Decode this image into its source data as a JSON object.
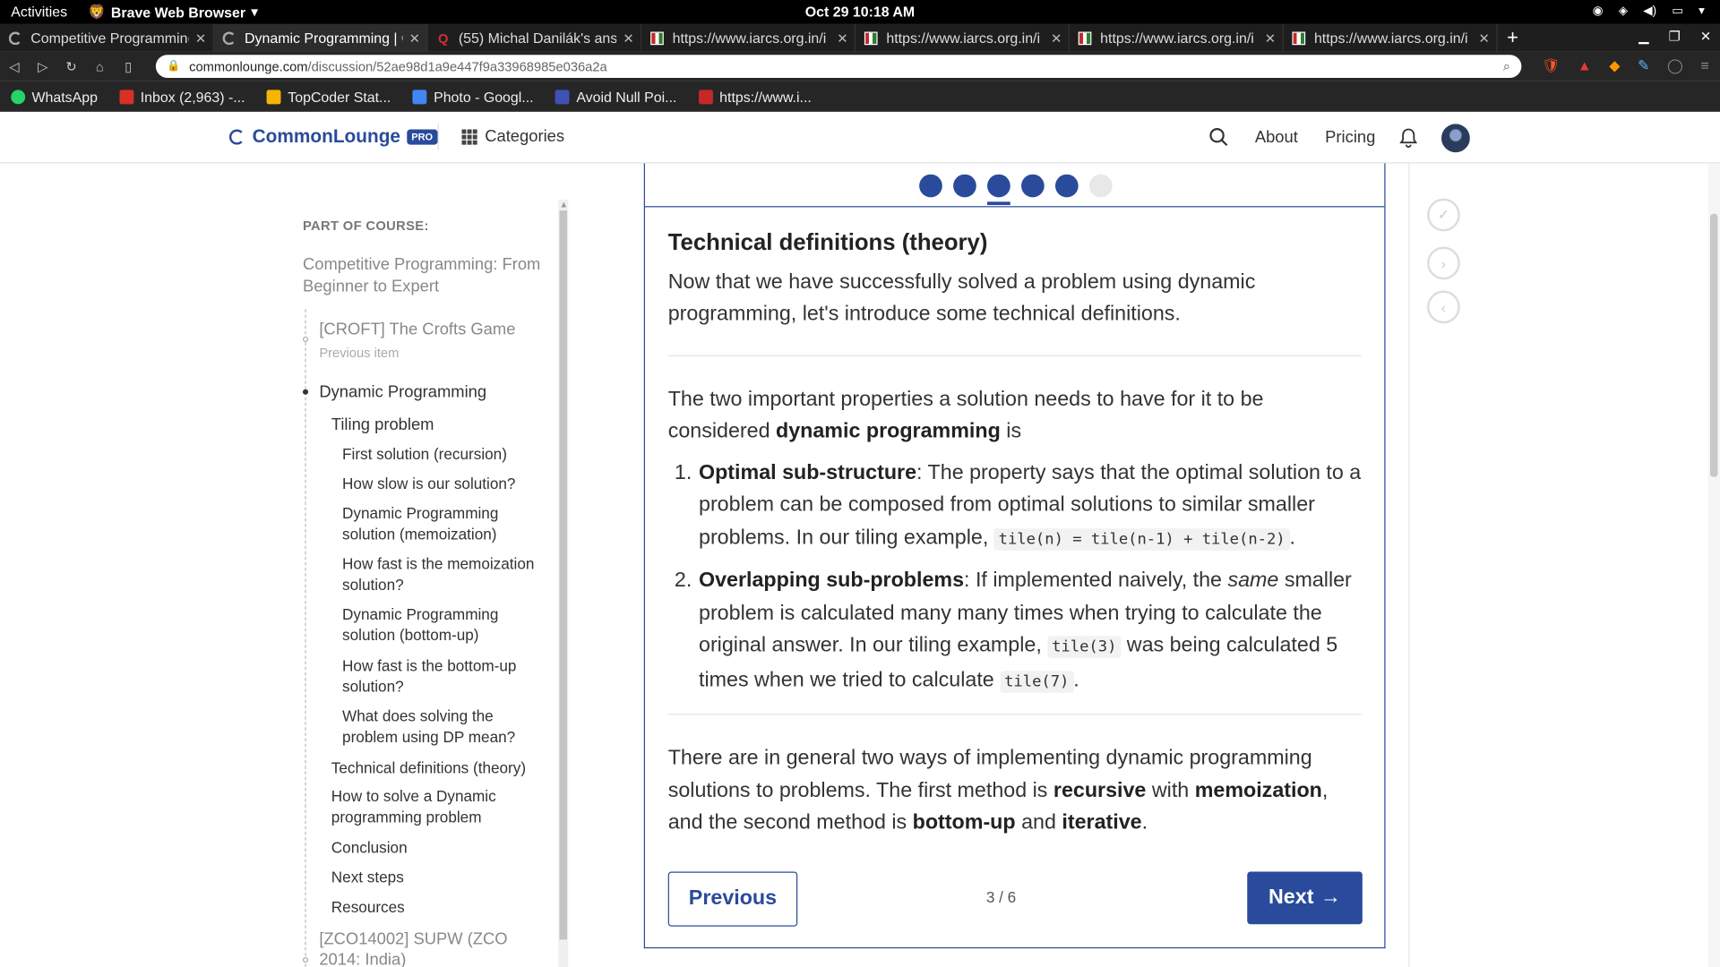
{
  "os": {
    "activities": "Activities",
    "app_menu": "Brave Web Browser",
    "clock": "Oct 29  10:18 AM"
  },
  "tabs": [
    {
      "title": "Competitive Programming",
      "active": false
    },
    {
      "title": "Dynamic Programming | Co",
      "active": true
    },
    {
      "title": "(55) Michal Danilák's answ",
      "active": false
    },
    {
      "title": "https://www.iarcs.org.in/i",
      "active": false
    },
    {
      "title": "https://www.iarcs.org.in/i",
      "active": false
    },
    {
      "title": "https://www.iarcs.org.in/i",
      "active": false
    },
    {
      "title": "https://www.iarcs.org.in/i",
      "active": false
    }
  ],
  "address": {
    "host": "commonlounge.com",
    "path": "/discussion/52ae98d1a9e447f9a33968985e036a2a"
  },
  "bookmarks": [
    {
      "label": "WhatsApp",
      "color": "#25d366"
    },
    {
      "label": "Inbox (2,963) -...",
      "color": "#d93025"
    },
    {
      "label": "TopCoder Stat...",
      "color": "#f4b400"
    },
    {
      "label": "Photo - Googl...",
      "color": "#4285f4"
    },
    {
      "label": "Avoid Null Poi...",
      "color": "#3f51b5"
    },
    {
      "label": "https://www.i...",
      "color": "#c62828"
    }
  ],
  "site": {
    "logo": "CommonLounge",
    "pro_badge": "PRO",
    "categories": "Categories",
    "about": "About",
    "pricing": "Pricing",
    "brand_color": "#2a4b9b"
  },
  "sidebar": {
    "part_of_course": "PART OF COURSE:",
    "course_title": "Competitive Programming: From Beginner to Expert",
    "previous_item": "[CROFT] The Crofts Game",
    "previous_label": "Previous item",
    "current_section": "Dynamic Programming",
    "subsection": "Tiling problem",
    "tiling_children": [
      "First solution (recursion)",
      "How slow is our solution?",
      "Dynamic Programming solution (memoization)",
      "How fast is the memoization solution?",
      "Dynamic Programming solution (bottom-up)",
      "How fast is the bottom-up solution?",
      "What does solving the problem using DP mean?"
    ],
    "sections": [
      "Technical definitions (theory)",
      "How to solve a Dynamic programming problem",
      "Conclusion",
      "Next steps",
      "Resources"
    ],
    "next_item": "[ZCO14002] SUPW (ZCO 2014: India)"
  },
  "progress": {
    "total": 6,
    "completed": 5,
    "current": 3
  },
  "article": {
    "heading": "Technical definitions (theory)",
    "intro": "Now that we have successfully solved a problem using dynamic programming, let's introduce some technical definitions.",
    "p2_pre": "The two important properties a solution needs to have for it to be considered ",
    "p2_bold": "dynamic programming",
    "p2_post": " is",
    "li1_title": "Optimal sub-structure",
    "li1_text": ": The property says that the optimal solution to a problem can be composed from optimal solutions to similar smaller problems. In our tiling example, ",
    "li1_code": "tile(n) = tile(n-1) + tile(n-2)",
    "li1_end": ".",
    "li2_title": "Overlapping sub-problems",
    "li2_text1": ": If implemented naively, the ",
    "li2_em": "same",
    "li2_text2": " smaller problem is calculated many many times when trying to calculate the original answer. In our tiling example, ",
    "li2_code1": "tile(3)",
    "li2_text3": " was being calculated 5 times when we tried to calculate ",
    "li2_code2": "tile(7)",
    "li2_end": ".",
    "p3_a": "There are in general two ways of implementing dynamic programming solutions to problems. The first method is ",
    "p3_b1": "recursive",
    "p3_c": " with ",
    "p3_b2": "memoization",
    "p3_d": ", and the second method is ",
    "p3_b3": "bottom-up",
    "p3_e": " and ",
    "p3_b4": "iterative",
    "p3_f": "."
  },
  "pager": {
    "previous": "Previous",
    "indicator": "3 / 6",
    "next": "Next",
    "next_arrow": "→"
  }
}
